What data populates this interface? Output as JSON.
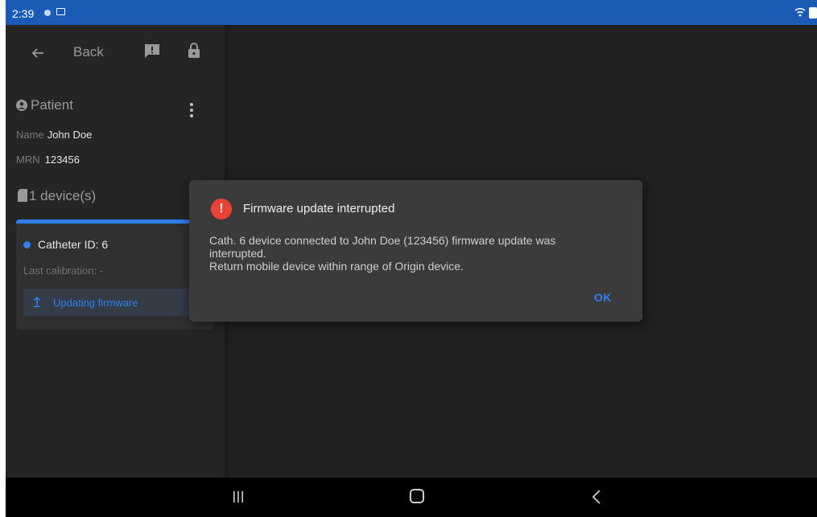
{
  "status_bar": {
    "time": "2:39",
    "icons": [
      "sync-icon",
      "image-icon",
      "wifi-icon",
      "battery-icon"
    ]
  },
  "sidebar": {
    "back_label": "Back",
    "patient": {
      "title": "Patient",
      "name_label": "Name",
      "name_value": "John Doe",
      "mrn_label": "MRN",
      "mrn_value": "123456"
    },
    "devices": {
      "title": "1 device(s)",
      "card": {
        "catheter_id": "Catheter ID: 6",
        "last_calibration": "Last calibration: -",
        "update_label": "Updating firmware"
      }
    }
  },
  "dialog": {
    "title": "Firmware update interrupted",
    "body_line1": "Cath. 6 device connected to John Doe (123456) firmware update was",
    "body_line2": "interrupted.",
    "body_line3": "Return mobile device within range of Origin device.",
    "ok_label": "OK"
  },
  "colors": {
    "accent": "#2f80ed",
    "status_bar": "#1a5bb8",
    "alert": "#ea4335"
  }
}
